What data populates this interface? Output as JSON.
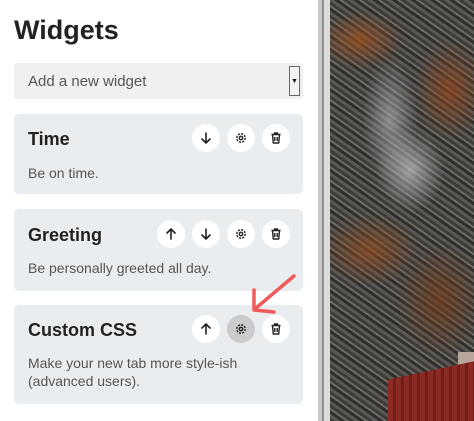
{
  "header": {
    "title": "Widgets"
  },
  "add_widget": {
    "placeholder": "Add a new widget",
    "arrow": "▼"
  },
  "widgets": [
    {
      "title": "Time",
      "description": "Be on time."
    },
    {
      "title": "Greeting",
      "description": "Be personally greeted all day."
    },
    {
      "title": "Custom CSS",
      "description": "Make your new tab more style-ish (advanced users)."
    }
  ],
  "icons": {
    "move_up": "arrow-up-icon",
    "move_down": "arrow-down-icon",
    "settings": "gear-icon",
    "delete": "trash-icon"
  },
  "colors": {
    "annotation": "#f05a5a",
    "card_bg": "#eaedef",
    "active_button": "#c9cbcd"
  }
}
